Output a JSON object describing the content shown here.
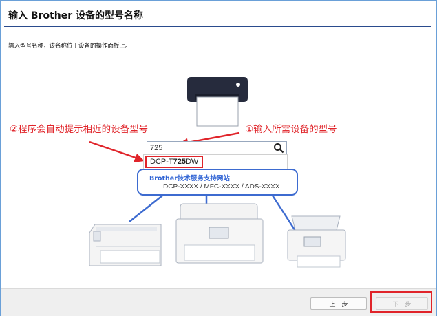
{
  "header": {
    "title": "输入 Brother 设备的型号名称"
  },
  "instruction": "输入型号名称，该名称位于设备的操作面板上。",
  "search": {
    "value": "725",
    "icon": "search-icon"
  },
  "suggestion": {
    "prefix": "DCP-T",
    "match": "725",
    "suffix": "DW"
  },
  "support": {
    "link_label": "Brother技术服务支持网站",
    "model_hint": "DCP-XXXX / MFC-XXXX / ADS-XXXX"
  },
  "annotations": {
    "left": "②程序会自动提示相近的设备型号",
    "right": "①输入所需设备的型号"
  },
  "footer": {
    "back_label": "上一步",
    "next_label": "下一步"
  },
  "colors": {
    "annotation_red": "#e0242a",
    "link_blue": "#2f63d4",
    "outline_blue": "#3d6bd0"
  }
}
